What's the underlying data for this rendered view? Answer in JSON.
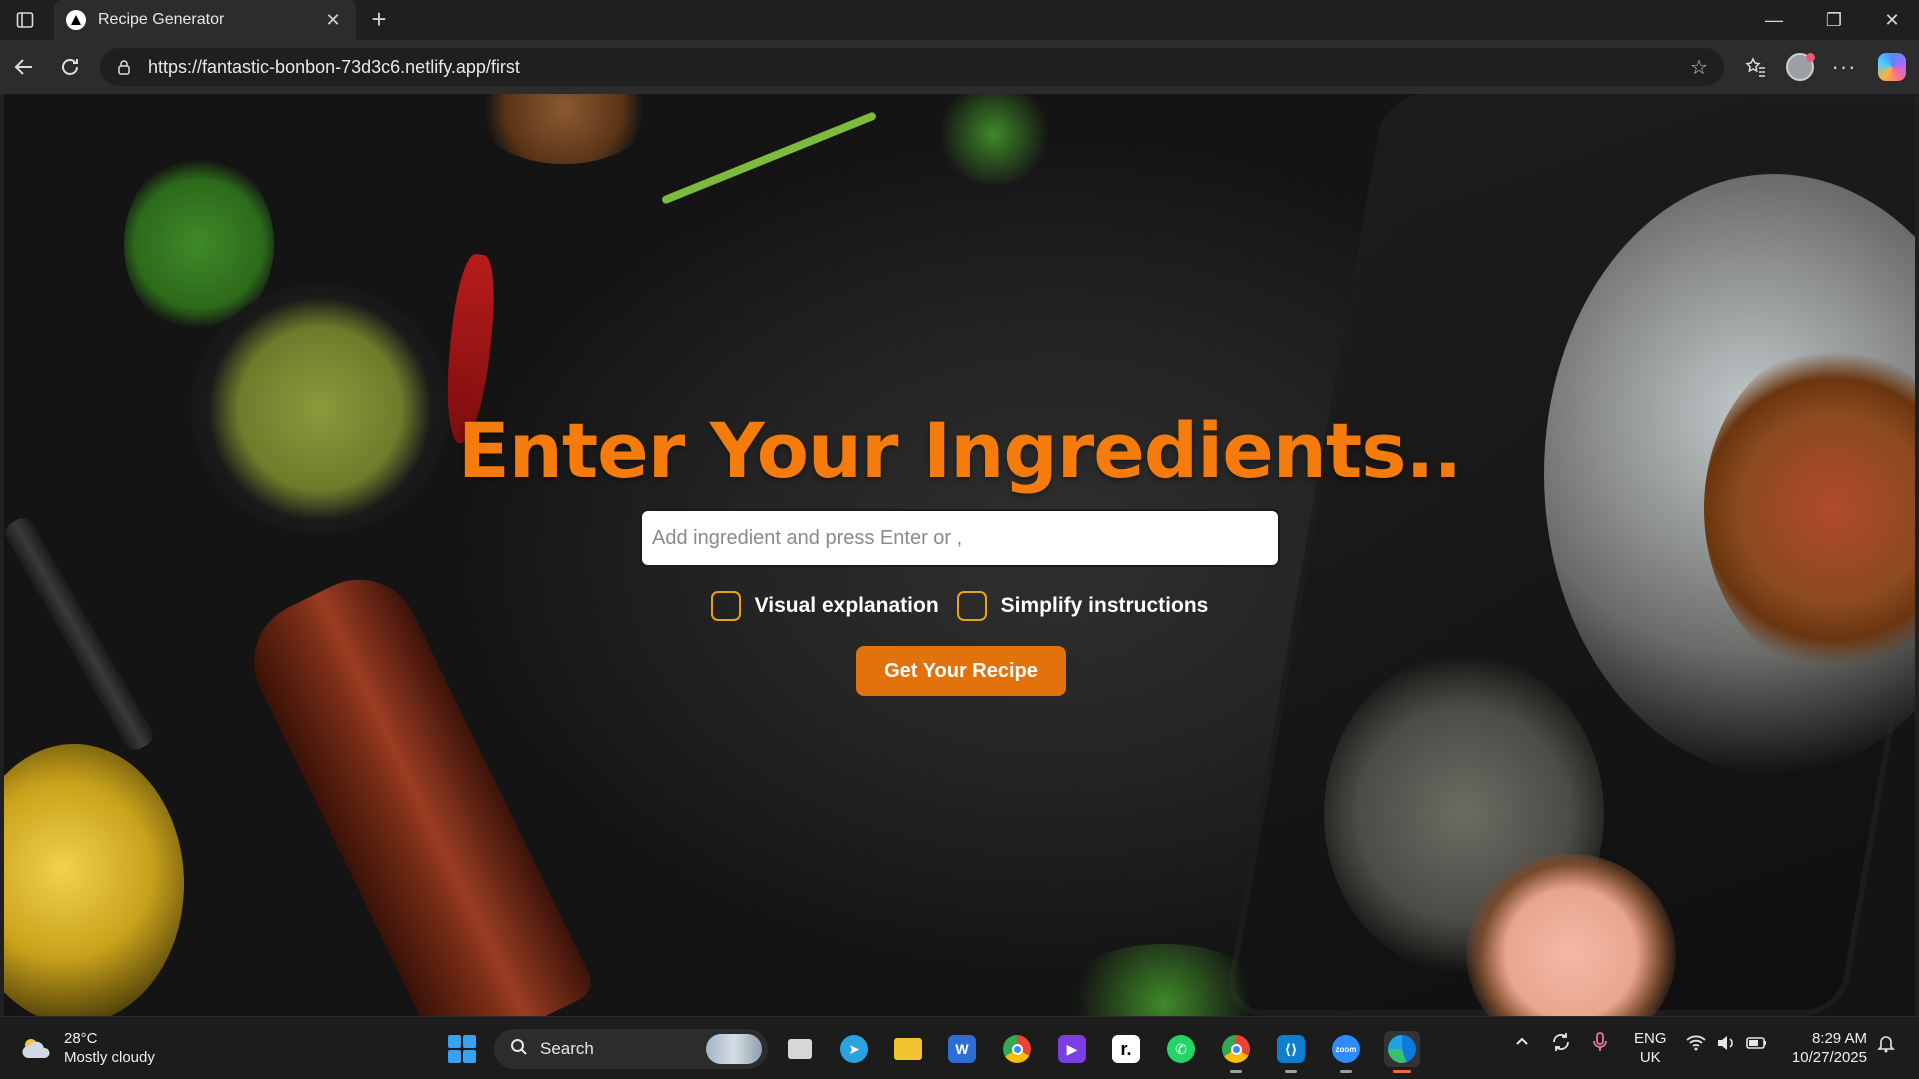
{
  "browser": {
    "tab": {
      "title": "Recipe Generator",
      "favicon": "triangle-logo-icon",
      "close_icon": "close-icon"
    },
    "new_tab_icon": "plus-icon",
    "window_controls": {
      "minimize": "minimize-icon",
      "restore": "restore-icon",
      "close": "close-icon"
    },
    "address": {
      "url": "https://fantastic-bonbon-73d3c6.netlify.app/first",
      "lock_icon": "site-info-icon"
    }
  },
  "page": {
    "title": "Enter Your Ingredients..",
    "input": {
      "placeholder": "Add ingredient and press Enter or ,",
      "value": ""
    },
    "options": [
      {
        "label": "Visual explanation",
        "checked": false
      },
      {
        "label": "Simplify instructions",
        "checked": false
      }
    ],
    "submit_label": "Get Your Recipe",
    "colors": {
      "accent": "#f47b0c",
      "button": "#e2730c",
      "checkbox_border": "#e8a21a"
    }
  },
  "taskbar": {
    "weather": {
      "temp": "28°C",
      "condition": "Mostly cloudy"
    },
    "search_label": "Search",
    "apps": [
      "task-view-icon",
      "telegram-icon",
      "file-explorer-icon",
      "word-icon",
      "chrome-icon",
      "visual-studio-icon",
      "app-r-icon",
      "whatsapp-icon",
      "chrome-profile-icon",
      "vscode-icon",
      "zoom-icon",
      "edge-icon"
    ],
    "language": {
      "line1": "ENG",
      "line2": "UK"
    },
    "clock": {
      "time": "8:29 AM",
      "date": "10/27/2025"
    }
  }
}
